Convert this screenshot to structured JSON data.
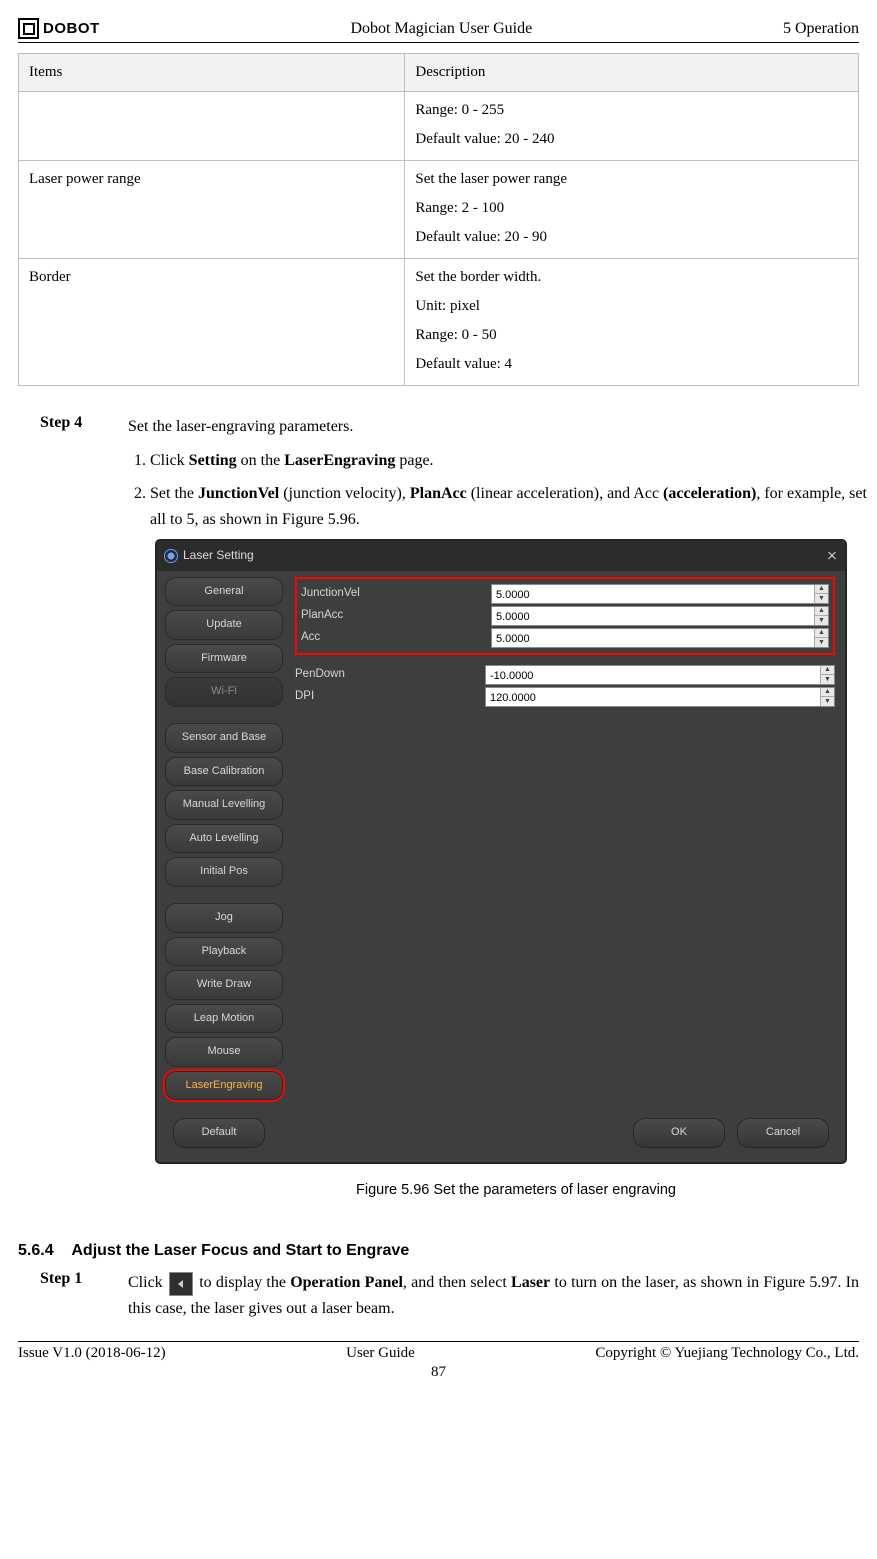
{
  "header": {
    "brand": "DOBOT",
    "center": "Dobot Magician User Guide",
    "right": "5 Operation"
  },
  "footer": {
    "left": "Issue V1.0 (2018-06-12)",
    "center": "User Guide",
    "right": "Copyright © Yuejiang Technology Co., Ltd.",
    "page": "87"
  },
  "table": {
    "head": {
      "items": "Items",
      "desc": "Description"
    },
    "rows": [
      {
        "item": "",
        "desc": [
          "Range: 0 - 255",
          "Default value: 20 - 240"
        ]
      },
      {
        "item": "Laser power range",
        "desc": [
          "Set the laser power range",
          "Range: 2 - 100",
          "Default value: 20 - 90"
        ]
      },
      {
        "item": "Border",
        "desc": [
          "Set the border width.",
          "Unit: pixel",
          "Range: 0 - 50",
          "Default value: 4"
        ]
      }
    ]
  },
  "step4": {
    "label": "Step 4",
    "lead": "Set the laser-engraving parameters.",
    "li1_a": "Click ",
    "li1_b": "Setting",
    "li1_c": " on the ",
    "li1_d": "LaserEngraving",
    "li1_e": " page.",
    "li2_a": "Set the ",
    "li2_b": "JunctionVel",
    "li2_c": " (junction velocity), ",
    "li2_d": "PlanAcc",
    "li2_e": " (linear acceleration), and Acc ",
    "li2_f": "(acceleration)",
    "li2_g": ", for example, set all to 5, as shown in Figure 5.96."
  },
  "dialog": {
    "title": "Laser Setting",
    "side": [
      "General",
      "Update",
      "Firmware",
      "Wi-Fi",
      "Sensor and Base",
      "Base Calibration",
      "Manual Levelling",
      "Auto Levelling",
      "Initial Pos",
      "Jog",
      "Playback",
      "Write  Draw",
      "Leap Motion",
      "Mouse",
      "LaserEngraving"
    ],
    "fields": {
      "JunctionVel": "5.0000",
      "PlanAcc": "5.0000",
      "Acc": "5.0000",
      "PenDown": "-10.0000",
      "DPI": "120.0000"
    },
    "buttons": {
      "default": "Default",
      "ok": "OK",
      "cancel": "Cancel"
    }
  },
  "figcap": "Figure 5.96    Set the parameters of laser engraving",
  "section564": {
    "num": "5.6.4",
    "title": "Adjust the Laser Focus and Start to Engrave"
  },
  "step1": {
    "label": "Step 1",
    "a": "Click  ",
    "b": "  to  display  the  ",
    "op": "Operation  Panel",
    "c": ",  and  then  select  ",
    "laser": "Laser",
    "d": "  to  turn  on  the laser, as shown in Figure 5.97. In this case, the laser gives out a laser beam."
  }
}
